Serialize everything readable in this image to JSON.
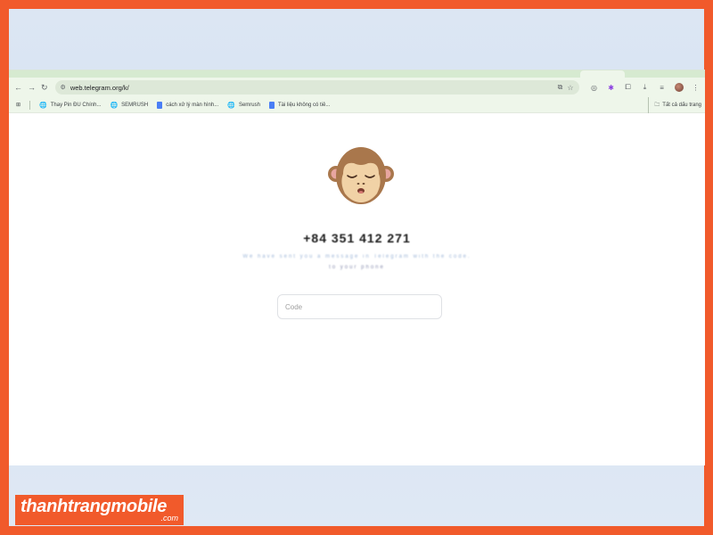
{
  "browser": {
    "url": "web.telegram.org/k/",
    "nav": {
      "back_icon": "←",
      "forward_icon": "→",
      "reload_icon": "↻",
      "site_info_icon": "⚙"
    },
    "omnibox_icons": {
      "install_icon": "⧉",
      "bookmark_star_icon": "☆"
    },
    "extensions": [
      "◎",
      "✱",
      "⧠",
      "⤓",
      "≡"
    ],
    "menu_icon": "⋮"
  },
  "bookmarks": {
    "apps_icon": "⊞",
    "items": [
      {
        "label": "Thay Pin ĐU Chính...",
        "icon": "globe"
      },
      {
        "label": "SEMRUSH",
        "icon": "globe"
      },
      {
        "label": "cách xử lý màn hình...",
        "icon": "doc"
      },
      {
        "label": "Semrush",
        "icon": "globe"
      },
      {
        "label": "Tài liệu không có tiê...",
        "icon": "doc"
      }
    ],
    "all_bookmarks": "Tất cả dấu trang"
  },
  "login": {
    "phone": "+84 351 412 271",
    "description_line1": "We have sent you a message in Telegram with the code.",
    "description_line2": "to your phone",
    "code_placeholder": "Code"
  },
  "watermark": {
    "brand": "thanhtrangmobile",
    "domain": ".com"
  },
  "colors": {
    "frame": "#f15a2b",
    "toolbar": "#eef6ea",
    "monkey_fur": "#a9774c",
    "monkey_face": "#f1d2a6"
  }
}
